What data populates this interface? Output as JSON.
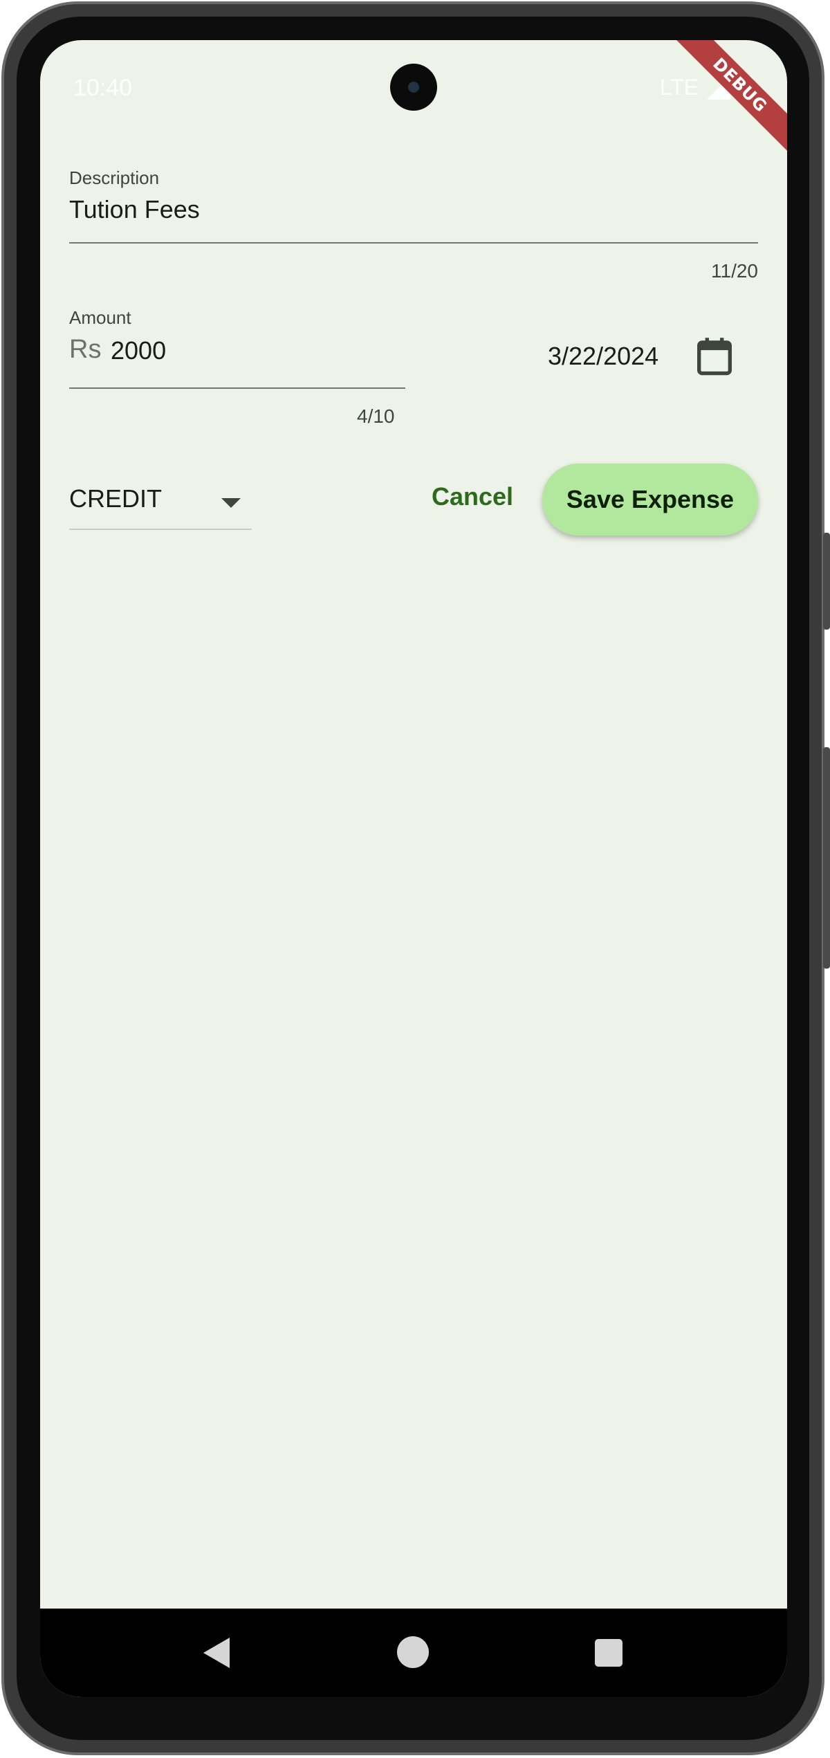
{
  "statusbar": {
    "time": "10:40",
    "network": "LTE",
    "signal_icon": "cell-signal-icon",
    "battery_icon": "battery-icon"
  },
  "debug_banner": "DEBUG",
  "form": {
    "description": {
      "label": "Description",
      "value": "Tution Fees",
      "counter": "11/20"
    },
    "amount": {
      "label": "Amount",
      "prefix": "Rs",
      "value": "2000",
      "counter": "4/10"
    },
    "date": {
      "value": "3/22/2024",
      "icon": "calendar-icon"
    },
    "category": {
      "selected": "CREDIT",
      "icon": "dropdown-arrow-icon"
    }
  },
  "actions": {
    "cancel_label": "Cancel",
    "save_label": "Save Expense"
  },
  "colors": {
    "background": "#edf3e8",
    "accent": "#2c6a1c",
    "button_fill": "#b1e89d",
    "debug_ribbon": "#b3403e"
  },
  "navbar": {
    "back_icon": "back-triangle-icon",
    "home_icon": "home-circle-icon",
    "recents_icon": "recents-square-icon"
  }
}
